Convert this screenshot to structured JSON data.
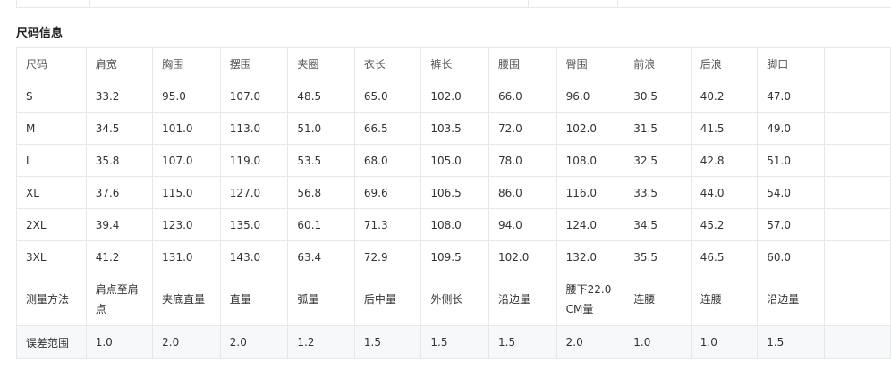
{
  "section": {
    "title": "尺码信息"
  },
  "table": {
    "headers": [
      "尺码",
      "肩宽",
      "胸围",
      "摆围",
      "夹圈",
      "衣长",
      "裤长",
      "腰围",
      "臀围",
      "前浪",
      "后浪",
      "脚口"
    ],
    "rows": [
      [
        "S",
        "33.2",
        "95.0",
        "107.0",
        "48.5",
        "65.0",
        "102.0",
        "66.0",
        "96.0",
        "30.5",
        "40.2",
        "47.0"
      ],
      [
        "M",
        "34.5",
        "101.0",
        "113.0",
        "51.0",
        "66.5",
        "103.5",
        "72.0",
        "102.0",
        "31.5",
        "41.5",
        "49.0"
      ],
      [
        "L",
        "35.8",
        "107.0",
        "119.0",
        "53.5",
        "68.0",
        "105.0",
        "78.0",
        "108.0",
        "32.5",
        "42.8",
        "51.0"
      ],
      [
        "XL",
        "37.6",
        "115.0",
        "127.0",
        "56.8",
        "69.6",
        "106.5",
        "86.0",
        "116.0",
        "33.5",
        "44.0",
        "54.0"
      ],
      [
        "2XL",
        "39.4",
        "123.0",
        "135.0",
        "60.1",
        "71.3",
        "108.0",
        "94.0",
        "124.0",
        "34.5",
        "45.2",
        "57.0"
      ],
      [
        "3XL",
        "41.2",
        "131.0",
        "143.0",
        "63.4",
        "72.9",
        "109.5",
        "102.0",
        "132.0",
        "35.5",
        "46.5",
        "60.0"
      ]
    ],
    "method_row": [
      "测量方法",
      "肩点至肩点",
      "夹底直量",
      "直量",
      "弧量",
      "后中量",
      "外侧长",
      "沿边量",
      "腰下22.0CM量",
      "连腰",
      "连腰",
      "沿边量"
    ],
    "tolerance_row": [
      "误差范围",
      "1.0",
      "2.0",
      "2.0",
      "1.2",
      "1.5",
      "1.5",
      "1.5",
      "2.0",
      "1.0",
      "1.0",
      "1.5"
    ]
  },
  "colors": {
    "border": "#e8e8e8",
    "tolerance_bg": "#f7f8fa",
    "text": "#333333"
  }
}
